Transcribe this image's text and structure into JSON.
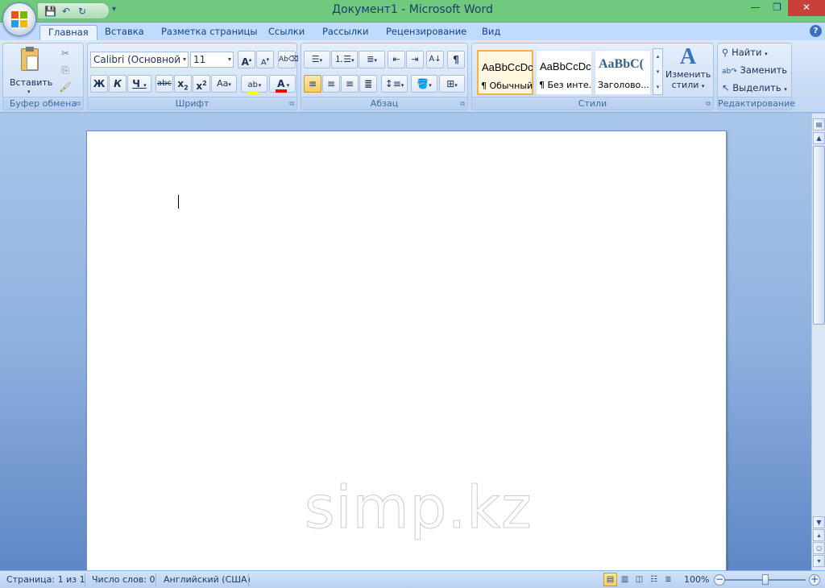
{
  "titlebar": {
    "title": "Документ1 - Microsoft Word"
  },
  "tabs": [
    {
      "label": "Главная",
      "active": true
    },
    {
      "label": "Вставка"
    },
    {
      "label": "Разметка страницы"
    },
    {
      "label": "Ссылки"
    },
    {
      "label": "Рассылки"
    },
    {
      "label": "Рецензирование"
    },
    {
      "label": "Вид"
    }
  ],
  "ribbon": {
    "clipboard": {
      "label": "Буфер обмена",
      "paste": "Вставить"
    },
    "font": {
      "label": "Шрифт",
      "family": "Calibri (Основной те",
      "size": "11"
    },
    "paragraph": {
      "label": "Абзац"
    },
    "styles": {
      "label": "Стили",
      "items": [
        {
          "preview": "AaBbCcDc",
          "name": "¶ Обычный"
        },
        {
          "preview": "AaBbCcDc",
          "name": "¶ Без инте..."
        },
        {
          "preview": "AaBbC(",
          "name": "Заголово..."
        }
      ],
      "change": "Изменить",
      "change2": "стили"
    },
    "editing": {
      "label": "Редактирование",
      "find": "Найти",
      "replace": "Заменить",
      "select": "Выделить"
    }
  },
  "document": {
    "watermark": "simp.kz"
  },
  "statusbar": {
    "page": "Страница: 1 из 1",
    "words": "Число слов: 0",
    "language": "Английский (США)",
    "zoom": "100%"
  },
  "colors": {
    "title_bar": "#6fc97e",
    "ribbon": "#dce9fb",
    "highlight": "#ffff00",
    "font_color": "#ff0000"
  }
}
